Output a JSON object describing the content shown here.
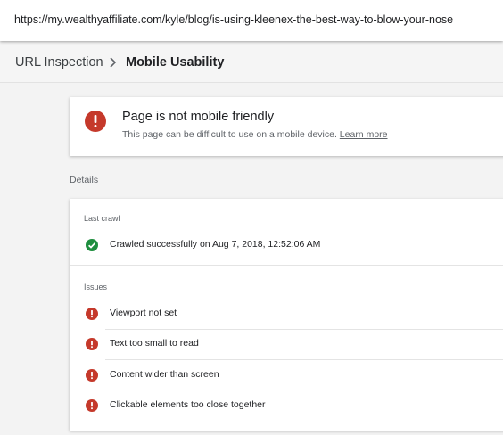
{
  "url_bar": {
    "url": "https://my.wealthyaffiliate.com/kyle/blog/is-using-kleenex-the-best-way-to-blow-your-nose"
  },
  "breadcrumb": {
    "parent": "URL Inspection",
    "current": "Mobile Usability"
  },
  "status": {
    "title": "Page is not mobile friendly",
    "description": "This page can be difficult to use on a mobile device.",
    "link": "Learn more",
    "icon": "error-icon",
    "color": "#c5392b"
  },
  "details": {
    "heading": "Details",
    "last_crawl": {
      "label": "Last crawl",
      "text": "Crawled successfully on Aug 7, 2018, 12:52:06 AM",
      "icon": "check-circle-icon",
      "color": "#1e8e3e"
    },
    "issues": {
      "label": "Issues",
      "items": [
        {
          "text": "Viewport not set"
        },
        {
          "text": "Text too small to read"
        },
        {
          "text": "Content wider than screen"
        },
        {
          "text": "Clickable elements too close together"
        }
      ]
    }
  }
}
